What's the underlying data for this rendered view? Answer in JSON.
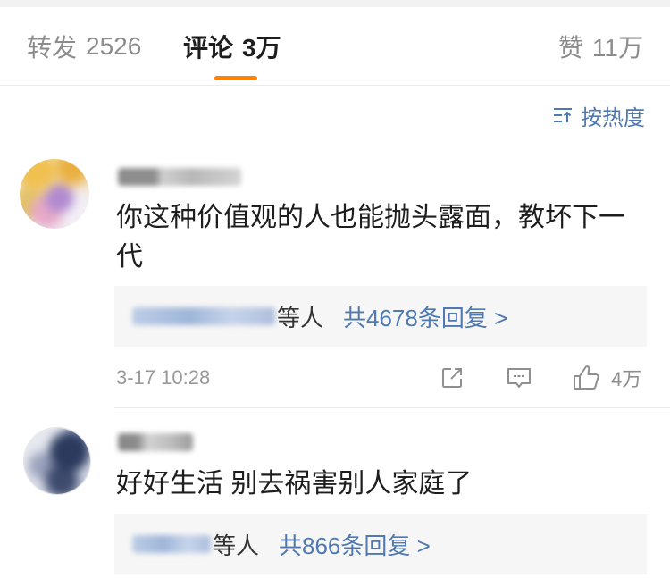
{
  "colors": {
    "accent": "#ff8200",
    "link": "#4f79b0",
    "text": "#1e1e1e",
    "muted": "#8c8c8c"
  },
  "header": {
    "tabs": [
      {
        "label": "转发",
        "count": "2526",
        "active": false
      },
      {
        "label": "评论",
        "count": "3万",
        "active": true
      }
    ],
    "likes": {
      "label": "赞",
      "count": "11万"
    }
  },
  "sort": {
    "label": "按热度",
    "icon": "sort-icon"
  },
  "comments": [
    {
      "text": "你这种价值观的人也能抛头露面，教坏下一代",
      "reply_summary": {
        "suffix": "等人",
        "link": "共4678条回复 >"
      },
      "time": "3-17 10:28",
      "like_count": "4万",
      "actions": [
        "share-icon",
        "comment-icon",
        "thumbs-up-icon"
      ]
    },
    {
      "text": "好好生活 别去祸害别人家庭了",
      "reply_summary": {
        "suffix": "等人",
        "link": "共866条回复 >"
      }
    }
  ]
}
